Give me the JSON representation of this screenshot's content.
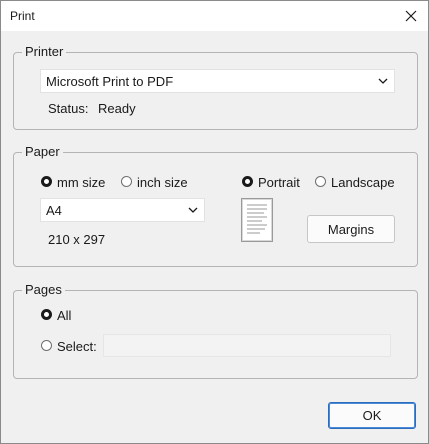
{
  "window": {
    "title": "Print"
  },
  "printer": {
    "legend": "Printer",
    "selected": "Microsoft Print to PDF",
    "status_label": "Status:",
    "status_value": "Ready"
  },
  "paper": {
    "legend": "Paper",
    "unit_options": [
      {
        "label": "mm size",
        "checked": true
      },
      {
        "label": "inch size",
        "checked": false
      }
    ],
    "orientation_options": [
      {
        "label": "Portrait",
        "checked": true
      },
      {
        "label": "Landscape",
        "checked": false
      }
    ],
    "size_selected": "A4",
    "dimensions": "210 x 297",
    "margins_label": "Margins"
  },
  "pages": {
    "legend": "Pages",
    "options": [
      {
        "label": "All",
        "checked": true
      },
      {
        "label": "Select:",
        "checked": false
      }
    ],
    "select_value": ""
  },
  "actions": {
    "ok_label": "OK"
  },
  "icons": {
    "close": "close-icon",
    "dropdown": "chevron-down-icon"
  }
}
